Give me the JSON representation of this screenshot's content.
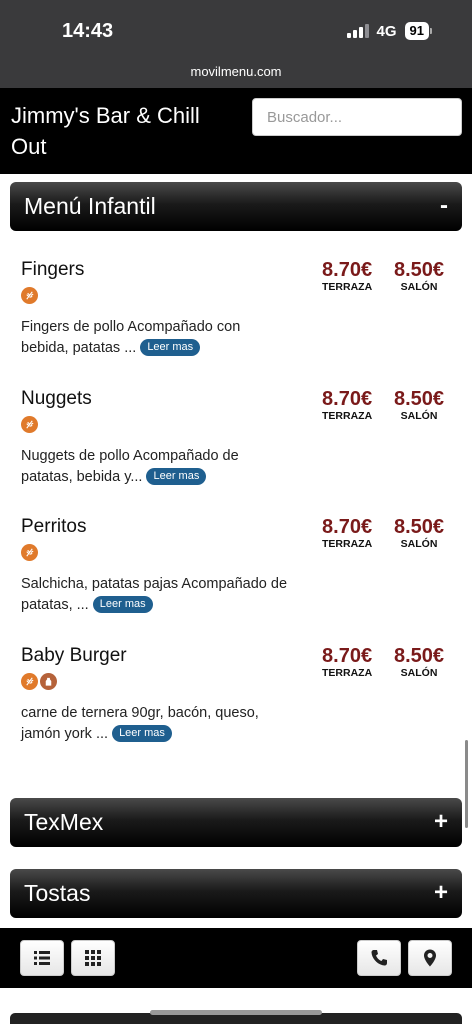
{
  "status": {
    "time": "14:43",
    "network": "4G",
    "battery": "91"
  },
  "browser": {
    "url": "movilmenu.com"
  },
  "header": {
    "title": "Jimmy's Bar & Chill Out",
    "search_placeholder": "Buscador..."
  },
  "sections": {
    "open": {
      "label": "Menú Infantil",
      "toggle": "-"
    },
    "texmex": {
      "label": "TexMex",
      "toggle": "+"
    },
    "tostas": {
      "label": "Tostas",
      "toggle": "+"
    }
  },
  "price_labels": {
    "terrace": "TERRAZA",
    "salon": "SALÓN"
  },
  "read_more": "Leer mas",
  "items": [
    {
      "name": "Fingers",
      "desc": "Fingers de pollo Acompañado con bebida, patatas ...",
      "price_terrace": "8.70€",
      "price_salon": "8.50€",
      "allergens": [
        "gluten"
      ]
    },
    {
      "name": "Nuggets",
      "desc": "Nuggets de pollo Acompañado de patatas, bebida y...",
      "price_terrace": "8.70€",
      "price_salon": "8.50€",
      "allergens": [
        "gluten"
      ]
    },
    {
      "name": "Perritos",
      "desc": "Salchicha, patatas pajas Acompañado de patatas, ...",
      "price_terrace": "8.70€",
      "price_salon": "8.50€",
      "allergens": [
        "gluten"
      ]
    },
    {
      "name": "Baby Burger",
      "desc": "carne de ternera 90gr, bacón, queso, jamón york ...",
      "price_terrace": "8.70€",
      "price_salon": "8.50€",
      "allergens": [
        "gluten",
        "milk"
      ]
    }
  ],
  "colors": {
    "price": "#7a1a1a",
    "badge_orange": "#e07a2b",
    "read_more_bg": "#1f5f8f"
  },
  "toolbar": {
    "icons": [
      "list-icon",
      "grid-icon",
      "phone-icon",
      "location-pin-icon"
    ]
  }
}
